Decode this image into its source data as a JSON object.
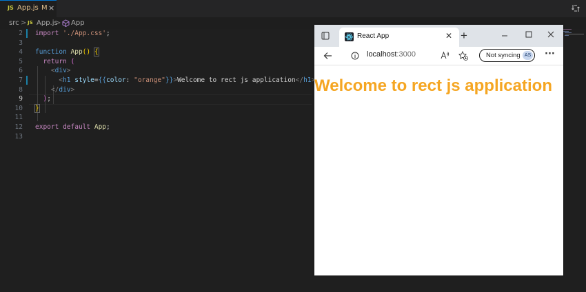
{
  "editor": {
    "tab": {
      "icon_text": "JS",
      "filename": "App.js",
      "status": "M",
      "close": "×"
    },
    "breadcrumb": {
      "folder": "src",
      "sep": ">",
      "file_icon": "JS",
      "file": "App.js",
      "symbol": "App"
    },
    "line_numbers": [
      "2",
      "3",
      "4",
      "5",
      "6",
      "7",
      "8",
      "9",
      "10",
      "11",
      "12",
      "13"
    ],
    "active_line": "9",
    "code_lines": [
      "import './App.css';",
      "",
      "function App() {",
      "  return (",
      "    <div>",
      "      <h1 style={{color: \"orange\"}}>Welcome to rect js application</h1>",
      "    </div>",
      "  );",
      "}",
      "",
      "export default App;",
      ""
    ]
  },
  "browser": {
    "tab_title": "React App",
    "tab_close": "✕",
    "new_tab": "+",
    "url_host": "localhost",
    "url_port": ":3000",
    "sync_label": "Not syncing",
    "avatar_initials": "AS",
    "more": "···",
    "page": {
      "heading": "Welcome to rect js application",
      "heading_color": "#f5a623"
    }
  }
}
